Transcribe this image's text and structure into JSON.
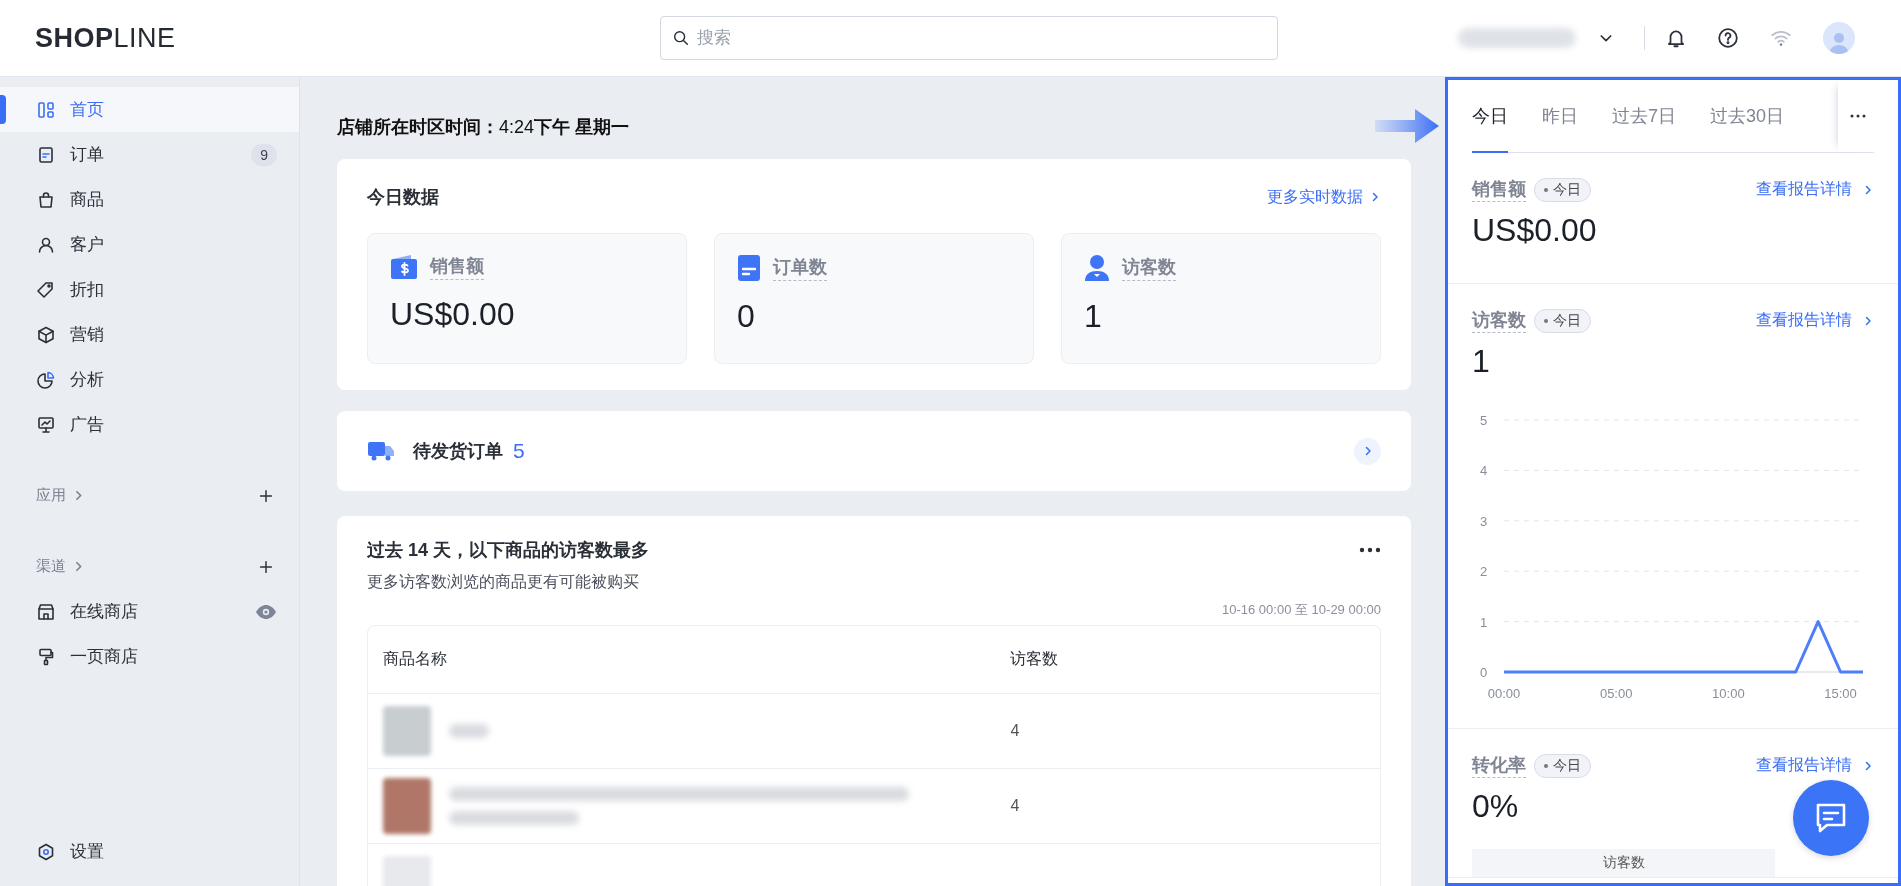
{
  "topbar": {
    "logo": "**SHOP**LINE",
    "search": {
      "placeholder": "搜索"
    }
  },
  "sidebar": {
    "items": [
      {
        "label": "首页",
        "selected": true
      },
      {
        "label": "订单",
        "selected": false,
        "badge": "9"
      },
      {
        "label": "商品",
        "selected": false
      },
      {
        "label": "客户",
        "selected": false
      },
      {
        "label": "折扣",
        "selected": false
      },
      {
        "label": "营销",
        "selected": false
      },
      {
        "label": "分析",
        "selected": false
      },
      {
        "label": "广告",
        "selected": false
      }
    ],
    "sections": [
      {
        "title": "应用"
      },
      {
        "title": "渠道",
        "items": [
          {
            "label": "在线商店",
            "selected": false
          },
          {
            "label": "一页商店",
            "selected": false
          }
        ]
      }
    ],
    "footer": {
      "label": "设置"
    }
  },
  "main": {
    "store_time": "**店铺所在时区时间：**4:24**下午 星期一**",
    "today": {
      "title": "今日数据",
      "link": "更多实时数据",
      "metrics": [
        {
          "label": "销售额",
          "value": "US$0.00"
        },
        {
          "label": "订单数",
          "value": "0"
        },
        {
          "label": "访客数",
          "value": "1"
        }
      ]
    },
    "pending": {
      "label": "待发货订单",
      "count": "5"
    },
    "top_products": {
      "title": "过去 14 天，以下商品的访客数最多",
      "subtitle": "更多访客数浏览的商品更有可能被购买",
      "date_range": "10-16 00:00 至 10-29 00:00",
      "columns": [
        "商品名称",
        "访客数"
      ],
      "rows": [
        {
          "kind": "short",
          "visitors": "4"
        },
        {
          "kind": "long",
          "visitors": "4"
        },
        {
          "kind": "cut"
        }
      ]
    }
  },
  "report_panel": {
    "tabs": [
      {
        "label": "今日",
        "selected": true
      },
      {
        "label": "昨日",
        "selected": false
      },
      {
        "label": "过去7日",
        "selected": false
      },
      {
        "label": "过去30日",
        "selected": false
      }
    ],
    "sections": [
      {
        "kind": "value",
        "title": "销售额",
        "tag": "今日",
        "link": "查看报告详情",
        "value": "US$0.00"
      },
      {
        "kind": "chart",
        "title": "访客数",
        "tag": "今日",
        "link": "查看报告详情",
        "value": "1",
        "chart_data": {
          "type": "line",
          "x": [
            0,
            1,
            2,
            3,
            4,
            5,
            6,
            7,
            8,
            9,
            10,
            11,
            12,
            13,
            14,
            15,
            16
          ],
          "xlim": [
            0,
            16
          ],
          "ylim": [
            0,
            5
          ],
          "series": [
            {
              "color": "#4d7ef7",
              "values": [
                0,
                0,
                0,
                0,
                0,
                0,
                0,
                0,
                0,
                0,
                0,
                0,
                0,
                0,
                1,
                0,
                0
              ]
            }
          ],
          "xticks": [
            {
              "value": 0,
              "label": "00:00"
            },
            {
              "value": 5,
              "label": "05:00"
            },
            {
              "value": 10,
              "label": "10:00"
            },
            {
              "value": 15,
              "label": "15:00"
            }
          ],
          "yticks": [
            0,
            1,
            2,
            3,
            4,
            5
          ],
          "grid": true
        }
      },
      {
        "kind": "funnel",
        "title": "转化率",
        "tag": "今日",
        "link": "查看报告详情",
        "value": "0%",
        "funnel_label": "访客数"
      }
    ]
  }
}
